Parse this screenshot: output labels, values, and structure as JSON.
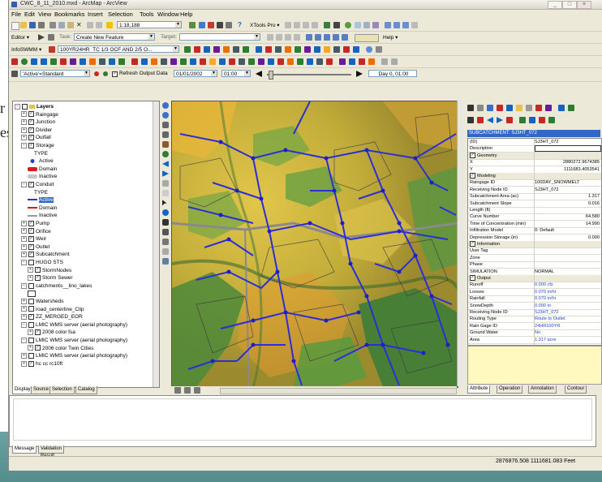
{
  "window": {
    "title": "CWC_8_11_2010.mxd - ArcMap - ArcView",
    "controls": [
      "_",
      "□",
      "×"
    ]
  },
  "slide": {
    "side_text": "r\nes"
  },
  "menu": [
    "File",
    "Edit",
    "View",
    "Bookmarks",
    "Insert",
    "Selection",
    "Tools",
    "Window",
    "Help"
  ],
  "toolbar1": {
    "scale": "1:18,188",
    "xtools_label": "XTools Pro ▾"
  },
  "toolbar2": {
    "editor_label": "Editor ▾",
    "task_label": "Task:",
    "task_value": "Create New Feature",
    "target_label": "Target:",
    "help_label": "Help ▾"
  },
  "toolbar3": {
    "infoswmm_label": "InfoSWMM ▾",
    "scenario_value": "100YR24HR_TC 1/3 OCF AND 2/5 O..."
  },
  "toolbar5": {
    "active_value": "'Active'=Standard",
    "refresh_label": "Refresh Output Data",
    "date_value": "01/01/2002",
    "time_value": "01:00",
    "day_label": "Day 0, 01:00"
  },
  "toc": {
    "rows": [
      {
        "depth": 0,
        "exp": "−",
        "cb": false,
        "text": "Layers",
        "bold": true
      },
      {
        "depth": 1,
        "exp": "+",
        "cb": true,
        "text": "Raingage"
      },
      {
        "depth": 1,
        "exp": "+",
        "cb": true,
        "text": "Junction"
      },
      {
        "depth": 1,
        "exp": "+",
        "cb": true,
        "text": "Divider"
      },
      {
        "depth": 1,
        "exp": "+",
        "cb": true,
        "text": "Outfall"
      },
      {
        "depth": 1,
        "exp": "−",
        "cb": true,
        "text": "Storage"
      },
      {
        "depth": 3,
        "text": "TYPE"
      },
      {
        "depth": 2,
        "sym": "pt-blue",
        "text": "Active"
      },
      {
        "depth": 2,
        "sym": "red-fill",
        "text": "Domain"
      },
      {
        "depth": 2,
        "sym": "gray-fill",
        "text": "Inactive"
      },
      {
        "depth": 1,
        "exp": "−",
        "cb": true,
        "text": "Conduit"
      },
      {
        "depth": 3,
        "text": "TYPE"
      },
      {
        "depth": 2,
        "sym": "line-blue",
        "text": "Active",
        "selected": true
      },
      {
        "depth": 2,
        "sym": "line-red",
        "text": "Domain"
      },
      {
        "depth": 2,
        "sym": "line-gray",
        "text": "Inactive"
      },
      {
        "depth": 1,
        "exp": "+",
        "cb": true,
        "text": "Pump"
      },
      {
        "depth": 1,
        "exp": "+",
        "cb": true,
        "text": "Orifice"
      },
      {
        "depth": 1,
        "exp": "+",
        "cb": true,
        "text": "Weir"
      },
      {
        "depth": 1,
        "exp": "+",
        "cb": true,
        "text": "Outlet"
      },
      {
        "depth": 1,
        "exp": "+",
        "cb": true,
        "text": "Subcatchment"
      },
      {
        "depth": 1,
        "exp": "−",
        "cb": false,
        "text": "HUGO STS"
      },
      {
        "depth": 2,
        "exp": "+",
        "cb": true,
        "text": "StormNodes"
      },
      {
        "depth": 2,
        "exp": "+",
        "cb": true,
        "text": "Storm Sewer"
      },
      {
        "depth": 1,
        "exp": "−",
        "cb": false,
        "text": "catchments__lino_lakes"
      },
      {
        "depth": 2,
        "sym": "box-empty",
        "text": ""
      },
      {
        "depth": 1,
        "exp": "+",
        "cb": false,
        "text": "Watersheds"
      },
      {
        "depth": 1,
        "exp": "+",
        "cb": false,
        "text": "road_centerline_Clip"
      },
      {
        "depth": 1,
        "exp": "+",
        "cb": true,
        "text": "ZZ_MERGED_EOR"
      },
      {
        "depth": 1,
        "exp": "−",
        "cb": false,
        "text": "LMIC WMS server (aerial photography)"
      },
      {
        "depth": 2,
        "exp": "+",
        "cb": true,
        "text": "2008 color fsa"
      },
      {
        "depth": 1,
        "exp": "−",
        "cb": false,
        "text": "LMIC WMS server (aerial photography)"
      },
      {
        "depth": 2,
        "exp": "+",
        "cb": true,
        "text": "2006 color Twin Cities"
      },
      {
        "depth": 1,
        "exp": "+",
        "cb": false,
        "text": "LMIC WMS server (aerial photography)"
      },
      {
        "depth": 1,
        "exp": "+",
        "cb": true,
        "text": "hc cc rc10ft"
      }
    ],
    "tabs": [
      "Display",
      "Source",
      "Selection",
      "Catalog"
    ]
  },
  "attributes": {
    "header": "SUBCATCHMENT: SJ3HT_072",
    "rows": [
      {
        "k": "(ID)",
        "v": "SJ3HT_072"
      },
      {
        "k": "Description",
        "v": ""
      },
      {
        "k": "Geometry",
        "v": "",
        "section": true
      },
      {
        "k": "X",
        "v": "2880272.9674385",
        "align": "r"
      },
      {
        "k": "Y",
        "v": "1111683.4053541",
        "align": "r"
      },
      {
        "k": "Modeling",
        "v": "",
        "section": true
      },
      {
        "k": "Raingage ID",
        "v": "100DAY_SNOWMELT"
      },
      {
        "k": "Receiving Node ID",
        "v": "SJ3HT_072"
      },
      {
        "k": "Subcatchment Area (ac)",
        "v": "1.317",
        "align": "r"
      },
      {
        "k": "Subcatchment Slope",
        "v": "0.016",
        "align": "r"
      },
      {
        "k": "Length (ft)",
        "v": "",
        "align": "r"
      },
      {
        "k": "Curve Number",
        "v": "64.580",
        "align": "r"
      },
      {
        "k": "Time of Concentration (min)",
        "v": "14.990",
        "align": "r"
      },
      {
        "k": "Infiltration Model",
        "v": "0: Default"
      },
      {
        "k": "Depression Storage (in)",
        "v": "0.000",
        "align": "r"
      },
      {
        "k": "Information",
        "v": "",
        "section": true
      },
      {
        "k": "User Tag",
        "v": ""
      },
      {
        "k": "Zone",
        "v": ""
      },
      {
        "k": "Phase",
        "v": ""
      },
      {
        "k": "SIMULATION",
        "v": "NORMAL"
      },
      {
        "k": "Output",
        "v": "",
        "section": true
      },
      {
        "k": "Runoff",
        "v": "0.000 cfs",
        "blue": true
      },
      {
        "k": "Losses",
        "v": "0.070 in/hr",
        "blue": true
      },
      {
        "k": "Rainfall",
        "v": "0.070 in/hr",
        "blue": true
      },
      {
        "k": "SnowDepth",
        "v": "0.000 in",
        "blue": true
      },
      {
        "k": "Receiving Node ID",
        "v": "SJ3HT_072",
        "blue": true
      },
      {
        "k": "Routing Type",
        "v": "Route to Outlet",
        "blue": true
      },
      {
        "k": "Rain Gage ID",
        "v": "24HR100YR",
        "blue": true
      },
      {
        "k": "Ground Water",
        "v": "No",
        "blue": true
      },
      {
        "k": "Area",
        "v": "1.317 acre",
        "blue": true
      }
    ],
    "tabs": [
      "Attribute",
      "Operation",
      "Annotation",
      "Contour"
    ]
  },
  "message": {
    "tabs": [
      "Message",
      "Validation Result"
    ]
  },
  "status": {
    "coordinates": "2876876.508  1111681.083 Feet"
  }
}
